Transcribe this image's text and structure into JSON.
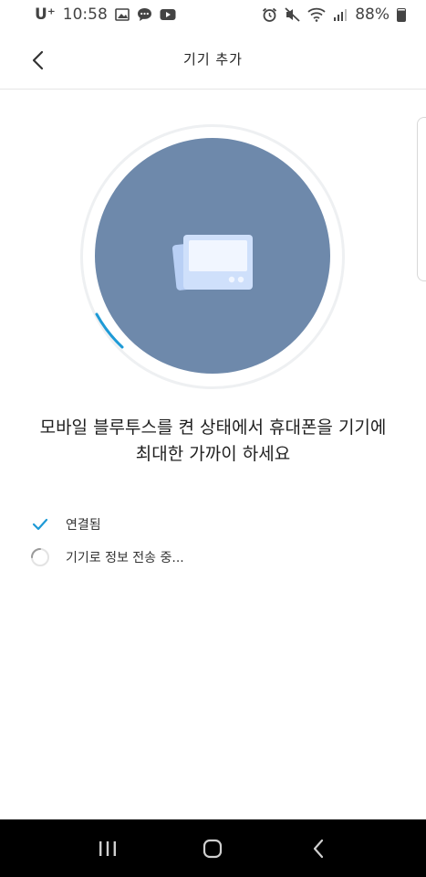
{
  "statusbar": {
    "carrier": "U⁺",
    "time": "10:58",
    "battery": "88%"
  },
  "header": {
    "title": "기기 추가"
  },
  "main": {
    "instruction_line1": "모바일 블루투스를 켠 상태에서 휴대폰을 기기에",
    "instruction_line2": "최대한 가까이 하세요",
    "steps": [
      {
        "label": "연결됨",
        "status": "done"
      },
      {
        "label": "기기로 정보 전송 중...",
        "status": "in-progress"
      }
    ]
  },
  "colors": {
    "accent": "#1e9ad6",
    "circle": "#6e89ab",
    "device": "#cfe0fb"
  }
}
